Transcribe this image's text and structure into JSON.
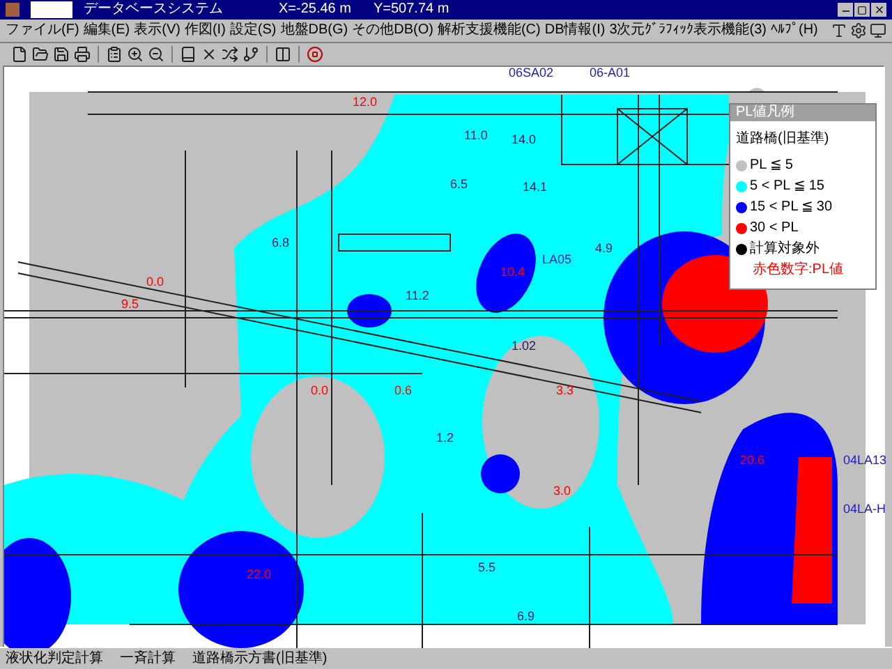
{
  "window": {
    "title": "データベースシステム",
    "x_coord": "X=-25.46 m",
    "y_coord": "Y=507.74 m"
  },
  "menu": [
    "ファイル(F)",
    "編集(E)",
    "表示(V)",
    "作図(I)",
    "設定(S)",
    "地盤DB(G)",
    "その他DB(O)",
    "解析支援機能(C)",
    "DB情報(I)",
    "3次元ｸﾞﾗﾌｨｯｸ表示機能(3)",
    "ﾍﾙﾌﾟ(H)"
  ],
  "map_labels": [
    {
      "text": "06SA02",
      "kind": "site"
    },
    {
      "text": "06-A01",
      "kind": "site"
    },
    {
      "text": "12.0",
      "kind": "pl"
    },
    {
      "text": "11.0",
      "kind": "point"
    },
    {
      "text": "14.0",
      "kind": "point"
    },
    {
      "text": "6.5",
      "kind": "point"
    },
    {
      "text": "14.1",
      "kind": "point"
    },
    {
      "text": "6.8",
      "kind": "point"
    },
    {
      "text": "4.9",
      "kind": "point"
    },
    {
      "text": "LA05",
      "kind": "site"
    },
    {
      "text": "10.4",
      "kind": "pl"
    },
    {
      "text": "11.2",
      "kind": "point"
    },
    {
      "text": "0.0",
      "kind": "pl"
    },
    {
      "text": "9.5",
      "kind": "pl"
    },
    {
      "text": "1.02",
      "kind": "point"
    },
    {
      "text": "0.0",
      "kind": "pl"
    },
    {
      "text": "0.6",
      "kind": "pl"
    },
    {
      "text": "3.3",
      "kind": "pl"
    },
    {
      "text": "1.2",
      "kind": "point"
    },
    {
      "text": "3.0",
      "kind": "pl"
    },
    {
      "text": "20.6",
      "kind": "pl"
    },
    {
      "text": "22.0",
      "kind": "pl"
    },
    {
      "text": "5.5",
      "kind": "point"
    },
    {
      "text": "6.9",
      "kind": "point"
    },
    {
      "text": "04LA13",
      "kind": "site"
    },
    {
      "text": "04LA-H",
      "kind": "site"
    }
  ],
  "legend": {
    "title": "PL値凡例",
    "heading": "道路橋(旧基準)",
    "items": [
      {
        "label": "PL ≦ 5",
        "color": "#c0c0c0"
      },
      {
        "label": "5 < PL ≦ 15",
        "color": "#00ffff"
      },
      {
        "label": "15 < PL ≦ 30",
        "color": "#0000ff"
      },
      {
        "label": "30 < PL",
        "color": "#ff0000"
      },
      {
        "label": "計算対象外",
        "color": "#000000"
      }
    ],
    "note": "赤色数字:PL値"
  },
  "status_bar": [
    "液状化判定計算",
    "一斉計算",
    "道路橋示方書(旧基準)"
  ]
}
